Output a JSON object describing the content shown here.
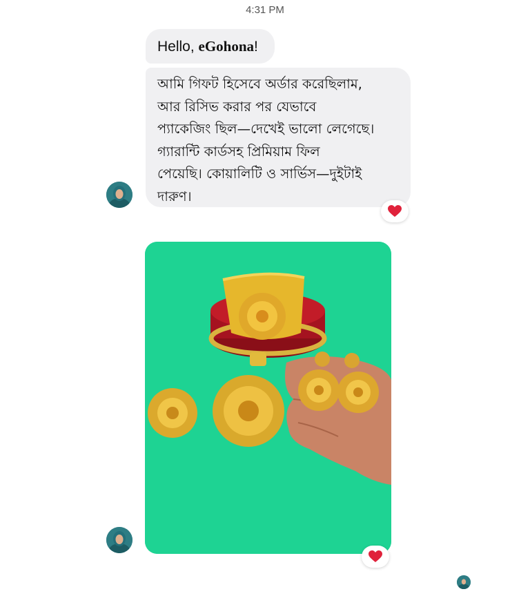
{
  "conversation": {
    "timestamp": "4:31 PM"
  },
  "messages": [
    {
      "greeting_prefix": "Hello, ",
      "greeting_brand": "eGohona",
      "greeting_suffix": "!"
    },
    {
      "lines": [
        "আমি গিফট হিসেবে অর্ডার করেছিলাম,",
        "আর রিসিভ করার পর যেভাবে",
        "প্যাকেজিং ছিল—দেখেই ভালো লেগেছে।",
        "গ্যারান্টি কার্ডসহ প্রিমিয়াম ফিল",
        "পেয়েছি। কোয়ালিটি ও সার্ভিস—দুইটাই",
        "দারুণ।"
      ],
      "reaction": "heart"
    },
    {
      "attachment": "photo",
      "reaction": "heart"
    }
  ],
  "colors": {
    "bubble": "#f0f0f2",
    "heart": "#e0223b",
    "photo_background": "#1ed393",
    "avatar": "#2e7d84"
  },
  "icons": [
    "avatar-icon",
    "heart-icon",
    "seen-avatar-icon"
  ]
}
